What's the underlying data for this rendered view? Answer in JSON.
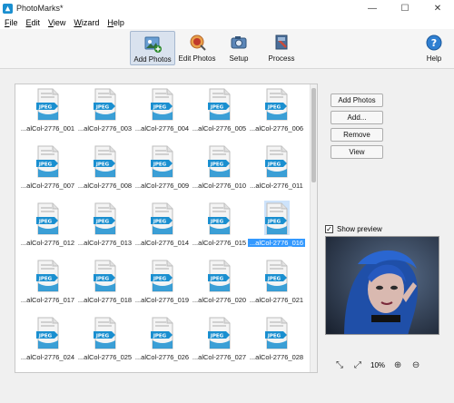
{
  "window": {
    "title": "PhotoMarks*",
    "minimize": "—",
    "maximize": "☐",
    "close": "✕"
  },
  "menu": [
    {
      "label": "File",
      "key": "F",
      "rest": "ile"
    },
    {
      "label": "Edit",
      "key": "E",
      "rest": "dit"
    },
    {
      "label": "View",
      "key": "V",
      "rest": "iew"
    },
    {
      "label": "Wizard",
      "key": "W",
      "rest": "izard"
    },
    {
      "label": "Help",
      "key": "H",
      "rest": "elp"
    }
  ],
  "toolbar": {
    "add_photos": "Add Photos",
    "edit_photos": "Edit Photos",
    "setup": "Setup",
    "process": "Process",
    "help": "Help"
  },
  "thumbnails": [
    "...alCol-2776_001",
    "...alCol-2776_003",
    "...alCol-2776_004",
    "...alCol-2776_005",
    "...alCol-2776_006",
    "...alCol-2776_007",
    "...alCol-2776_008",
    "...alCol-2776_009",
    "...alCol-2776_010",
    "...alCol-2776_011",
    "...alCol-2776_012",
    "...alCol-2776_013",
    "...alCol-2776_014",
    "...alCol-2776_015",
    "...alCol-2776_016",
    "...alCol-2776_017",
    "...alCol-2776_018",
    "...alCol-2776_019",
    "...alCol-2776_020",
    "...alCol-2776_021",
    "...alCol-2776_024",
    "...alCol-2776_025",
    "...alCol-2776_026",
    "...alCol-2776_027",
    "...alCol-2776_028"
  ],
  "thumb_badge": "JPEG",
  "selected_index": 14,
  "side_buttons": {
    "add_photos": "Add Photos",
    "add": "Add...",
    "remove": "Remove",
    "view": "View"
  },
  "preview": {
    "show_label": "Show preview",
    "checked": true
  },
  "zoom": {
    "level": "10%"
  },
  "colors": {
    "accent": "#1a8fd0",
    "selection": "#3399ff",
    "toolbar_active": "#d9e2ee"
  }
}
